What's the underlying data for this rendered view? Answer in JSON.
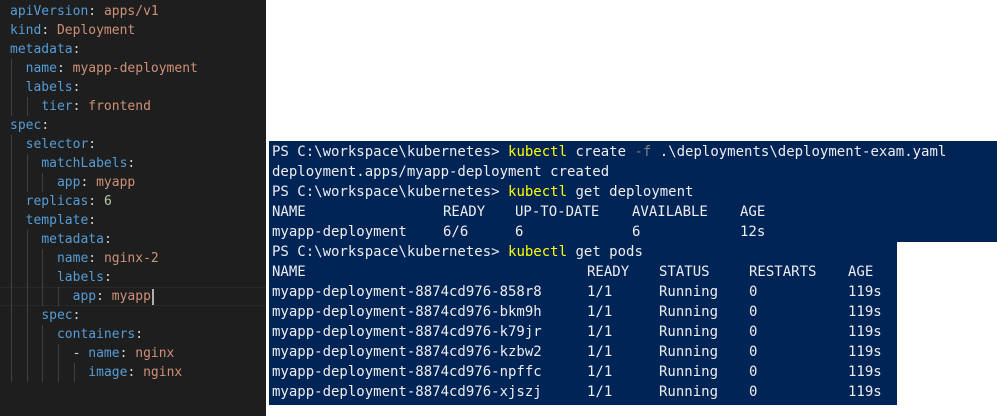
{
  "editor": {
    "lines": [
      {
        "indent": 0,
        "tokens": [
          {
            "t": "apiVersion",
            "c": "k"
          },
          {
            "t": ": ",
            "c": "p"
          },
          {
            "t": "apps/v1",
            "c": "s"
          }
        ]
      },
      {
        "indent": 0,
        "tokens": [
          {
            "t": "kind",
            "c": "k"
          },
          {
            "t": ": ",
            "c": "p"
          },
          {
            "t": "Deployment",
            "c": "s"
          }
        ]
      },
      {
        "indent": 0,
        "tokens": [
          {
            "t": "metadata",
            "c": "k"
          },
          {
            "t": ":",
            "c": "p"
          }
        ]
      },
      {
        "indent": 1,
        "tokens": [
          {
            "t": "name",
            "c": "k"
          },
          {
            "t": ": ",
            "c": "p"
          },
          {
            "t": "myapp-deployment",
            "c": "s"
          }
        ]
      },
      {
        "indent": 1,
        "tokens": [
          {
            "t": "labels",
            "c": "k"
          },
          {
            "t": ":",
            "c": "p"
          }
        ]
      },
      {
        "indent": 2,
        "tokens": [
          {
            "t": "tier",
            "c": "k"
          },
          {
            "t": ": ",
            "c": "p"
          },
          {
            "t": "frontend",
            "c": "s"
          }
        ]
      },
      {
        "indent": 0,
        "tokens": [
          {
            "t": "spec",
            "c": "k"
          },
          {
            "t": ":",
            "c": "p"
          }
        ]
      },
      {
        "indent": 1,
        "tokens": [
          {
            "t": "selector",
            "c": "k"
          },
          {
            "t": ":",
            "c": "p"
          }
        ]
      },
      {
        "indent": 2,
        "tokens": [
          {
            "t": "matchLabels",
            "c": "k"
          },
          {
            "t": ":",
            "c": "p"
          }
        ]
      },
      {
        "indent": 3,
        "tokens": [
          {
            "t": "app",
            "c": "k"
          },
          {
            "t": ": ",
            "c": "p"
          },
          {
            "t": "myapp",
            "c": "s"
          }
        ]
      },
      {
        "indent": 1,
        "tokens": [
          {
            "t": "replicas",
            "c": "k"
          },
          {
            "t": ": ",
            "c": "p"
          },
          {
            "t": "6",
            "c": "n"
          }
        ]
      },
      {
        "indent": 1,
        "tokens": [
          {
            "t": "template",
            "c": "k"
          },
          {
            "t": ":",
            "c": "p"
          }
        ]
      },
      {
        "indent": 2,
        "tokens": [
          {
            "t": "metadata",
            "c": "k"
          },
          {
            "t": ":",
            "c": "p"
          }
        ]
      },
      {
        "indent": 3,
        "tokens": [
          {
            "t": "name",
            "c": "k"
          },
          {
            "t": ": ",
            "c": "p"
          },
          {
            "t": "nginx-2",
            "c": "s"
          }
        ]
      },
      {
        "indent": 3,
        "tokens": [
          {
            "t": "labels",
            "c": "k"
          },
          {
            "t": ":",
            "c": "p"
          }
        ]
      },
      {
        "indent": 4,
        "tokens": [
          {
            "t": "app",
            "c": "k"
          },
          {
            "t": ": ",
            "c": "p"
          },
          {
            "t": "myapp",
            "c": "s"
          }
        ]
      },
      {
        "indent": 2,
        "tokens": [
          {
            "t": "spec",
            "c": "k"
          },
          {
            "t": ":",
            "c": "p"
          }
        ]
      },
      {
        "indent": 3,
        "tokens": [
          {
            "t": "containers",
            "c": "k"
          },
          {
            "t": ":",
            "c": "p"
          }
        ]
      },
      {
        "indent": 4,
        "tokens": [
          {
            "t": "- ",
            "c": "p"
          },
          {
            "t": "name",
            "c": "k"
          },
          {
            "t": ": ",
            "c": "p"
          },
          {
            "t": "nginx",
            "c": "s"
          }
        ]
      },
      {
        "indent": 5,
        "tokens": [
          {
            "t": "image",
            "c": "k"
          },
          {
            "t": ": ",
            "c": "p"
          },
          {
            "t": "nginx",
            "c": "s"
          }
        ]
      }
    ],
    "cursor_line": 15
  },
  "terminal": {
    "lines": [
      {
        "kind": "prompt",
        "prompt": "PS C:\\workspace\\kubernetes> ",
        "cmd": "kubectl",
        "before_flag": " create ",
        "flag": "-f",
        "rest": " .\\deployments\\deployment-exam.yaml"
      },
      {
        "kind": "text",
        "text": "deployment.apps/myapp-deployment created"
      },
      {
        "kind": "prompt",
        "prompt": "PS C:\\workspace\\kubernetes> ",
        "cmd": "kubectl",
        "before_flag": " get deployment",
        "flag": "",
        "rest": ""
      },
      {
        "kind": "table",
        "table": "deploy",
        "row": "header"
      },
      {
        "kind": "table",
        "table": "deploy",
        "row": 0
      },
      {
        "kind": "prompt",
        "prompt": "PS C:\\workspace\\kubernetes> ",
        "cmd": "kubectl",
        "before_flag": " get pods",
        "flag": "",
        "rest": ""
      },
      {
        "kind": "table",
        "table": "pods",
        "row": "header"
      },
      {
        "kind": "table",
        "table": "pods",
        "row": 0
      },
      {
        "kind": "table",
        "table": "pods",
        "row": 1
      },
      {
        "kind": "table",
        "table": "pods",
        "row": 2
      },
      {
        "kind": "table",
        "table": "pods",
        "row": 3
      },
      {
        "kind": "table",
        "table": "pods",
        "row": 4
      },
      {
        "kind": "table",
        "table": "pods",
        "row": 5
      }
    ],
    "tables": {
      "deploy": {
        "columns": [
          "NAME",
          "READY",
          "UP-TO-DATE",
          "AVAILABLE",
          "AGE"
        ],
        "rows": [
          [
            "myapp-deployment",
            "6/6",
            "6",
            "6",
            "12s"
          ]
        ]
      },
      "pods": {
        "columns": [
          "NAME",
          "READY",
          "STATUS",
          "RESTARTS",
          "AGE"
        ],
        "rows": [
          [
            "myapp-deployment-8874cd976-858r8",
            "1/1",
            "Running",
            "0",
            "119s"
          ],
          [
            "myapp-deployment-8874cd976-bkm9h",
            "1/1",
            "Running",
            "0",
            "119s"
          ],
          [
            "myapp-deployment-8874cd976-k79jr",
            "1/1",
            "Running",
            "0",
            "119s"
          ],
          [
            "myapp-deployment-8874cd976-kzbw2",
            "1/1",
            "Running",
            "0",
            "119s"
          ],
          [
            "myapp-deployment-8874cd976-npffc",
            "1/1",
            "Running",
            "0",
            "119s"
          ],
          [
            "myapp-deployment-8874cd976-xjszj",
            "1/1",
            "Running",
            "0",
            "119s"
          ]
        ]
      }
    }
  },
  "colors": {
    "editor_bg": "#1e1e1e",
    "yaml_key": "#569cd6",
    "yaml_string": "#ce9178",
    "yaml_number": "#b5cea8",
    "terminal_bg": "#012456",
    "terminal_text": "#eeedf0",
    "terminal_command": "#ffff00",
    "terminal_flag": "#808080"
  }
}
